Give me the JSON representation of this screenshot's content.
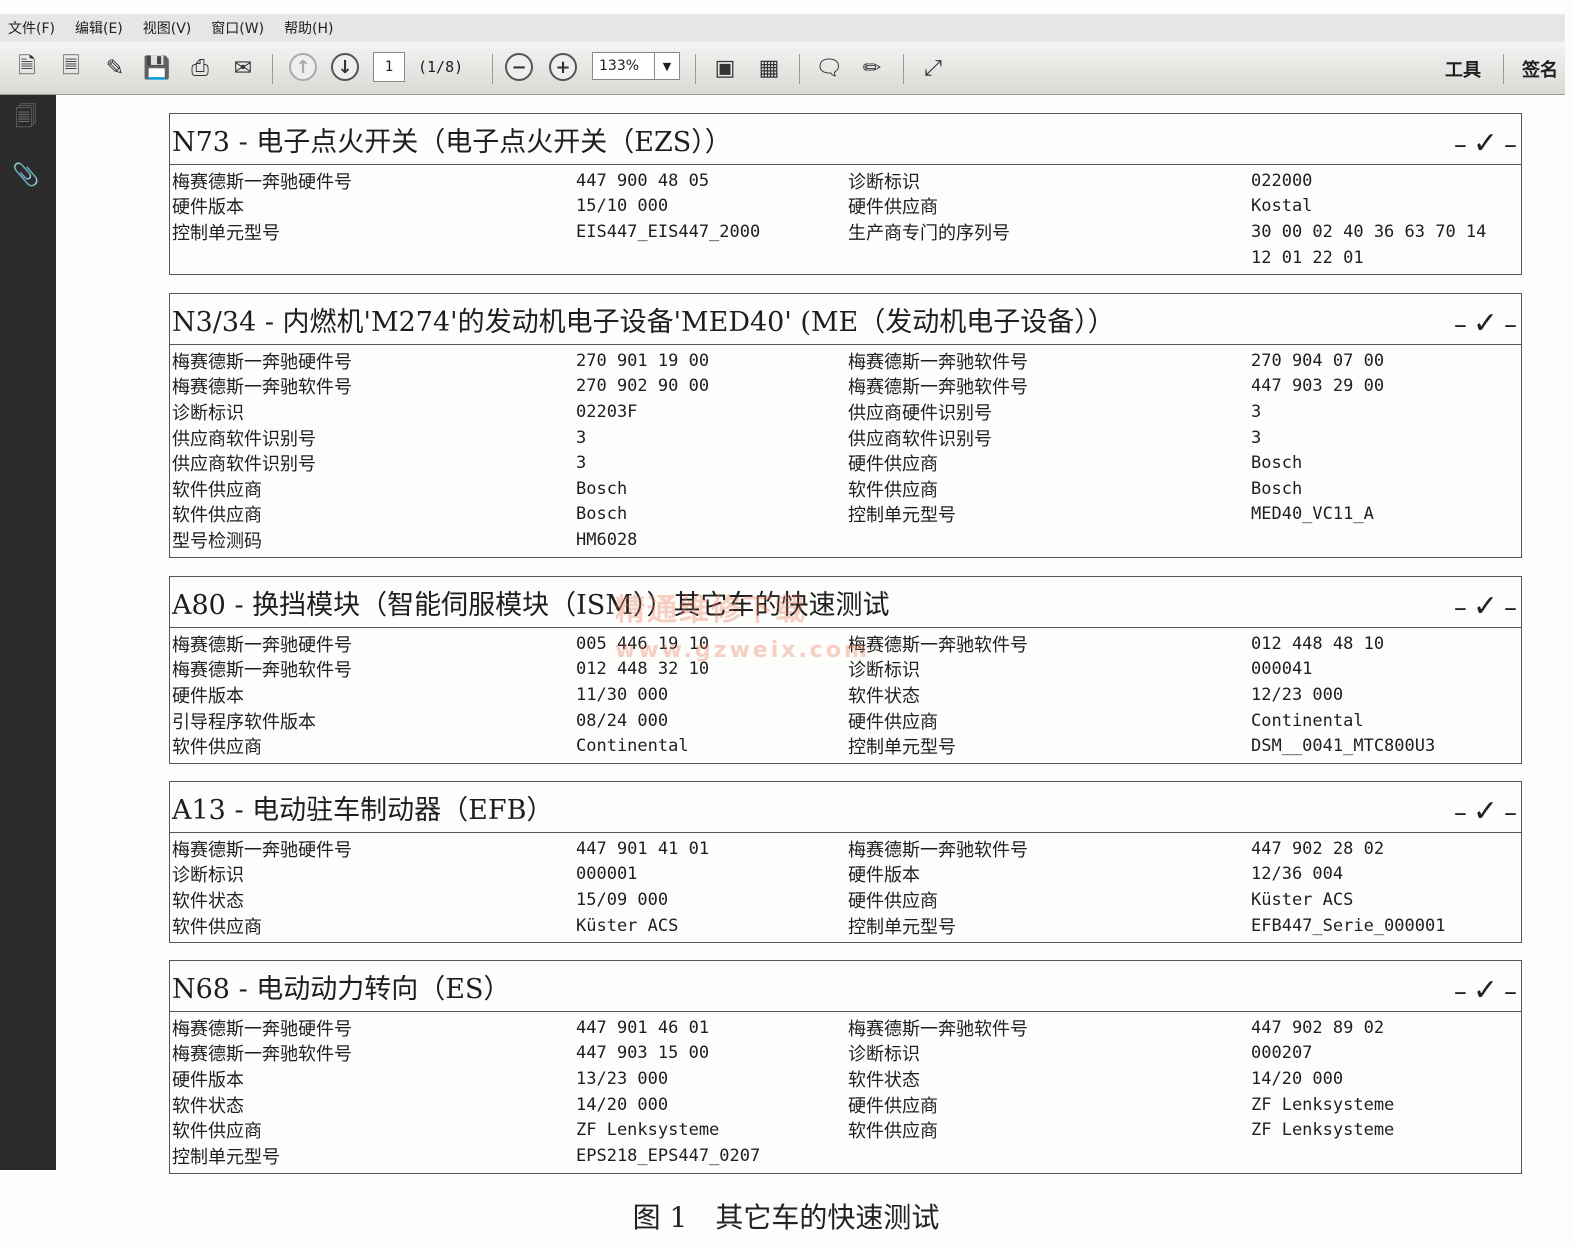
{
  "menu": [
    "文件(F)",
    "编辑(E)",
    "视图(V)",
    "窗口(W)",
    "帮助(H)"
  ],
  "toolbar": {
    "page_current": "1",
    "page_count": "(1/8)",
    "zoom": "133%",
    "tools_label": "工具",
    "sign_label": "签名"
  },
  "watermark": {
    "line1": "精通维修下载",
    "line2": "www.gzweix.com"
  },
  "modules": [
    {
      "title": "N73 - 电子点火开关（电子点火开关（EZS））",
      "rows": [
        [
          "梅赛德斯一奔驰硬件号",
          "447 900 48 05",
          "诊断标识",
          "022000"
        ],
        [
          "硬件版本",
          "15/10 000",
          "硬件供应商",
          "Kostal"
        ],
        [
          "控制单元型号",
          "EIS447_EIS447_2000",
          "生产商专门的序列号",
          "30 00 02 40 36 63 70 14"
        ],
        [
          "",
          "",
          "",
          "12 01 22 01"
        ]
      ]
    },
    {
      "title": "N3/34 - 内燃机'M274'的发动机电子设备'MED40' (ME（发动机电子设备））",
      "rows": [
        [
          "梅赛德斯一奔驰硬件号",
          "270 901 19 00",
          "梅赛德斯一奔驰软件号",
          "270 904 07 00"
        ],
        [
          "梅赛德斯一奔驰软件号",
          "270 902 90 00",
          "梅赛德斯一奔驰软件号",
          "447 903 29 00"
        ],
        [
          "诊断标识",
          "02203F",
          "供应商硬件识别号",
          "3"
        ],
        [
          "供应商软件识别号",
          "3",
          "供应商软件识别号",
          "3"
        ],
        [
          "供应商软件识别号",
          "3",
          "硬件供应商",
          "Bosch"
        ],
        [
          "软件供应商",
          "Bosch",
          "软件供应商",
          "Bosch"
        ],
        [
          "软件供应商",
          "Bosch",
          "控制单元型号",
          "MED40_VC11_A"
        ],
        [
          "型号检测码",
          "HM6028",
          "",
          ""
        ]
      ]
    },
    {
      "title": "A80 - 换挡模块（智能伺服模块（ISM））其它车的快速测试",
      "rows": [
        [
          "梅赛德斯一奔驰硬件号",
          "005 446 19 10",
          "梅赛德斯一奔驰软件号",
          "012 448 48 10"
        ],
        [
          "梅赛德斯一奔驰软件号",
          "012 448 32 10",
          "诊断标识",
          "000041"
        ],
        [
          "硬件版本",
          "11/30 000",
          "软件状态",
          "12/23 000"
        ],
        [
          "引导程序软件版本",
          "08/24 000",
          "硬件供应商",
          "Continental"
        ],
        [
          "软件供应商",
          "Continental",
          "控制单元型号",
          "DSM__0041_MTC800U3"
        ]
      ]
    },
    {
      "title": "A13 - 电动驻车制动器（EFB）",
      "rows": [
        [
          "梅赛德斯一奔驰硬件号",
          "447 901 41 01",
          "梅赛德斯一奔驰软件号",
          "447 902 28 02"
        ],
        [
          "诊断标识",
          "000001",
          "硬件版本",
          "12/36 004"
        ],
        [
          "软件状态",
          "15/09 000",
          "硬件供应商",
          "Küster ACS"
        ],
        [
          "软件供应商",
          "Küster ACS",
          "控制单元型号",
          "EFB447_Serie_000001"
        ]
      ]
    },
    {
      "title": "N68 - 电动动力转向（ES）",
      "rows": [
        [
          "梅赛德斯一奔驰硬件号",
          "447 901 46 01",
          "梅赛德斯一奔驰软件号",
          "447 902 89 02"
        ],
        [
          "梅赛德斯一奔驰软件号",
          "447 903 15 00",
          "诊断标识",
          "000207"
        ],
        [
          "硬件版本",
          "13/23 000",
          "软件状态",
          "14/20 000"
        ],
        [
          "软件状态",
          "14/20 000",
          "硬件供应商",
          "ZF Lenksysteme"
        ],
        [
          "软件供应商",
          "ZF Lenksysteme",
          "软件供应商",
          "ZF Lenksysteme"
        ],
        [
          "控制单元型号",
          "EPS218_EPS447_0207",
          "",
          ""
        ]
      ]
    }
  ],
  "status_mark": "✓",
  "caption": "图 1　其它车的快速测试"
}
